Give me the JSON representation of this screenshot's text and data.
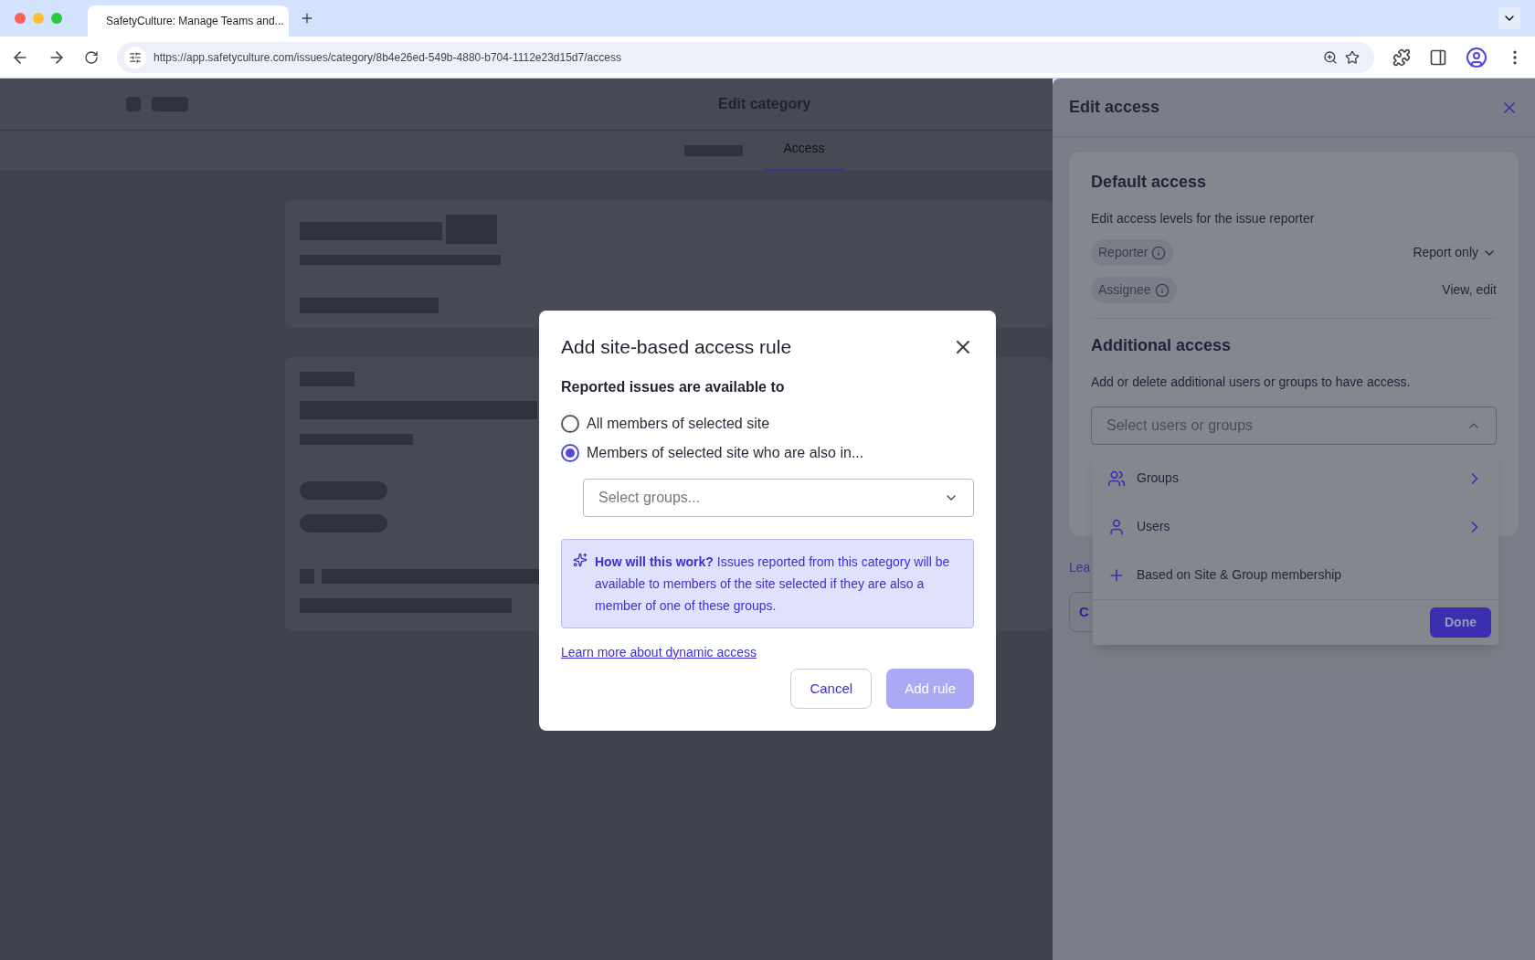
{
  "browser": {
    "tab_title": "SafetyCulture: Manage Teams and...",
    "url": "https://app.safetyculture.com/issues/category/8b4e26ed-549b-4880-b704-1112e23d15d7/access"
  },
  "page": {
    "title": "Edit category",
    "access_tab": {
      "label": "Access",
      "selected": true
    }
  },
  "modal": {
    "title": "Add site-based access rule",
    "subtitle": "Reported issues are available to",
    "options": [
      {
        "label": "All members of selected site",
        "selected": false
      },
      {
        "label": "Members of selected site who are also in...",
        "selected": true
      }
    ],
    "groups_select": {
      "placeholder": "Select groups..."
    },
    "info": "**How will this work?** Issues reported from this category will be available to members of the site selected if they are also a member of one of these groups.",
    "link": "Learn more about dynamic access",
    "buttons": [
      {
        "label": "Cancel",
        "kind": "secondary",
        "disabled": false
      },
      {
        "label": "Add rule",
        "kind": "primary",
        "disabled": true
      }
    ]
  },
  "panel": {
    "title": "Edit access",
    "default_title": "Default access",
    "default_text": "Edit access levels for the issue reporter",
    "roles": [
      {
        "role": "Reporter",
        "value": "Report only",
        "kind": "dropdown"
      },
      {
        "role": "Assignee",
        "value": "View, edit",
        "kind": "text"
      }
    ],
    "additional_title": "Additional access",
    "additional_text": "Add or delete additional users or groups to have access.",
    "select": {
      "placeholder": "Select users or groups",
      "expanded": true
    },
    "menu": [
      {
        "label": "Groups",
        "kind": "groups"
      },
      {
        "label": "Users",
        "kind": "users"
      },
      {
        "label": "Based on Site & Group membership",
        "kind": "add"
      }
    ],
    "done": "Done",
    "footer_link": "Lea",
    "footer_button": "C"
  }
}
